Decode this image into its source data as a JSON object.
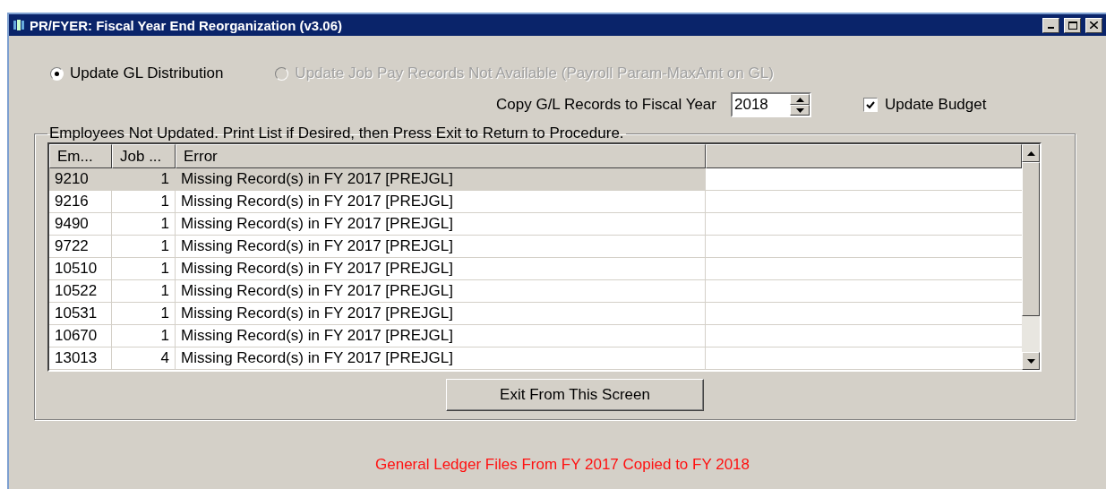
{
  "window": {
    "title": "PR/FYER: Fiscal Year End Reorganization (v3.06)"
  },
  "options": [
    {
      "label": "Update GL Distribution",
      "selected": true,
      "disabled": false
    },
    {
      "label": "Update Job Pay Records Not Available (Payroll Param-MaxAmt on GL)",
      "selected": false,
      "disabled": true
    }
  ],
  "copy_year": {
    "label": "Copy G/L Records to Fiscal Year",
    "value": "2018"
  },
  "update_budget": {
    "label": "Update Budget",
    "checked": true
  },
  "group": {
    "title": "Employees Not Updated. Print List if Desired, then Press Exit to Return to Procedure."
  },
  "table": {
    "columns": [
      "Em...",
      "Job ...",
      "Error"
    ],
    "rows": [
      {
        "cells": [
          "9210",
          "1",
          "Missing Record(s) in FY 2017 [PREJGL]"
        ],
        "selected": true
      },
      {
        "cells": [
          "9216",
          "1",
          "Missing Record(s) in FY 2017 [PREJGL]"
        ],
        "selected": false
      },
      {
        "cells": [
          "9490",
          "1",
          "Missing Record(s) in FY 2017 [PREJGL]"
        ],
        "selected": false
      },
      {
        "cells": [
          "9722",
          "1",
          "Missing Record(s) in FY 2017 [PREJGL]"
        ],
        "selected": false
      },
      {
        "cells": [
          "10510",
          "1",
          "Missing Record(s) in FY 2017 [PREJGL]"
        ],
        "selected": false
      },
      {
        "cells": [
          "10522",
          "1",
          "Missing Record(s) in FY 2017 [PREJGL]"
        ],
        "selected": false
      },
      {
        "cells": [
          "10531",
          "1",
          "Missing Record(s) in FY 2017 [PREJGL]"
        ],
        "selected": false
      },
      {
        "cells": [
          "10670",
          "1",
          "Missing Record(s) in FY 2017 [PREJGL]"
        ],
        "selected": false
      },
      {
        "cells": [
          "13013",
          "4",
          "Missing Record(s) in FY 2017 [PREJGL]"
        ],
        "selected": false
      }
    ]
  },
  "exit_button": "Exit From This Screen",
  "status_message": "General Ledger Files From FY 2017 Copied to FY 2018"
}
